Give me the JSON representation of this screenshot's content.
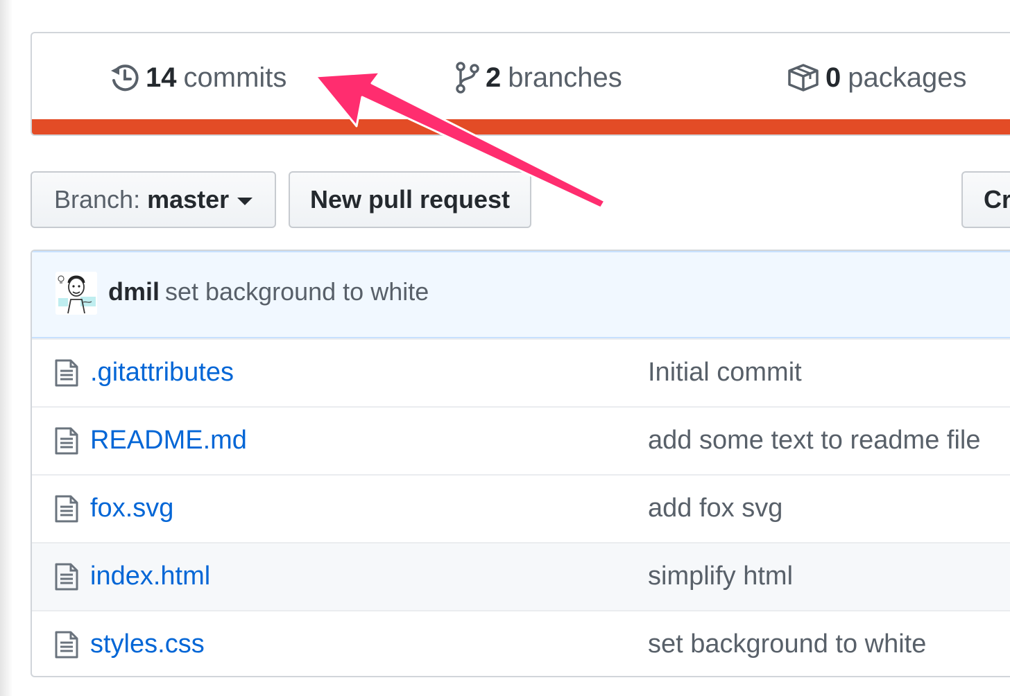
{
  "summary": {
    "commits": {
      "count": "14",
      "label": "commits"
    },
    "branches": {
      "count": "2",
      "label": "branches"
    },
    "packages": {
      "count": "0",
      "label": "packages"
    },
    "language_bar_color": "#e34c26"
  },
  "toolbar": {
    "branch_prefix": "Branch:",
    "branch_name": "master",
    "new_pull_request": "New pull request",
    "create_partial": "Cr"
  },
  "latest_commit": {
    "author": "dmil",
    "message": "set background to white"
  },
  "files": [
    {
      "name": ".gitattributes",
      "message": "Initial commit",
      "icon": "file-icon"
    },
    {
      "name": "README.md",
      "message": "add some text to readme file",
      "icon": "file-icon"
    },
    {
      "name": "fox.svg",
      "message": "add fox svg",
      "icon": "file-icon"
    },
    {
      "name": "index.html",
      "message": "simplify html",
      "icon": "file-icon"
    },
    {
      "name": "styles.css",
      "message": "set background to white",
      "icon": "file-icon"
    }
  ],
  "colors": {
    "link": "#0366d6",
    "annotation_arrow": "#ff2d6f",
    "commit_tease_bg": "#f1f8ff"
  }
}
